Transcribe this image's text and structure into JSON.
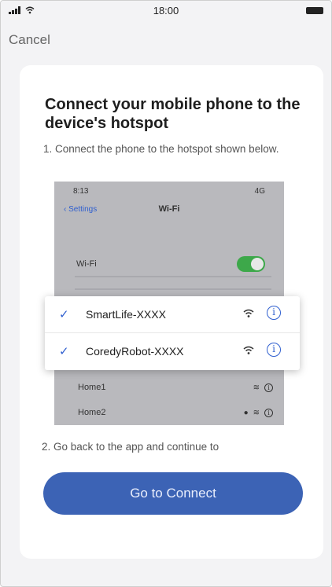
{
  "status_bar": {
    "time": "18:00"
  },
  "nav": {
    "cancel_label": "Cancel"
  },
  "card": {
    "title": "Connect your mobile phone to the device's hotspot",
    "step1": "1. Connect the phone to the hotspot shown below.",
    "step2": "2. Go back to the app and continue to",
    "button_label": "Go to Connect"
  },
  "illustration": {
    "time": "8:13",
    "carrier": "4G",
    "back_label": "Settings",
    "title": "Wi-Fi",
    "wifi_label": "Wi-Fi",
    "wifi_on": true,
    "networks": [
      {
        "name": "SmartLife-XXXX",
        "checked": true
      },
      {
        "name": "CoredyRobot-XXXX",
        "checked": true
      }
    ],
    "home_networks": [
      "Home1",
      "Home2"
    ]
  },
  "colors": {
    "accent": "#3c63b5",
    "toggle": "#3da84a",
    "link": "#2f5fcf"
  }
}
